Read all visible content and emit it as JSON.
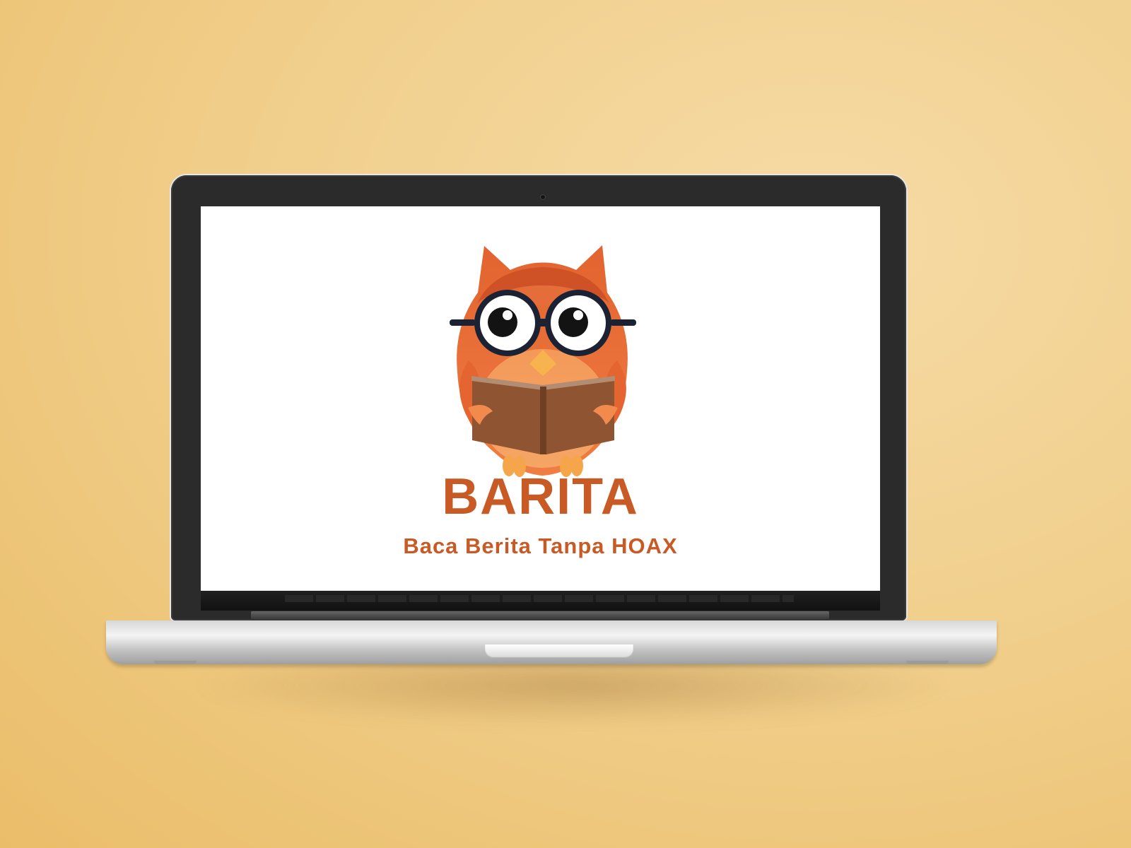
{
  "background": {
    "color": "#f1d08e"
  },
  "laptop": {
    "lid_color": "#2b2b2b",
    "body_color": "#d6d6d6"
  },
  "screen": {
    "logo": {
      "name": "owl-reading-book-logo",
      "brand": "BARITA",
      "tagline": "Baca Berita Tanpa HOAX",
      "primary_color": "#c85b25",
      "accent_color": "#f08b4b",
      "book_color": "#8f5432",
      "glasses_color": "#1b2233"
    }
  }
}
